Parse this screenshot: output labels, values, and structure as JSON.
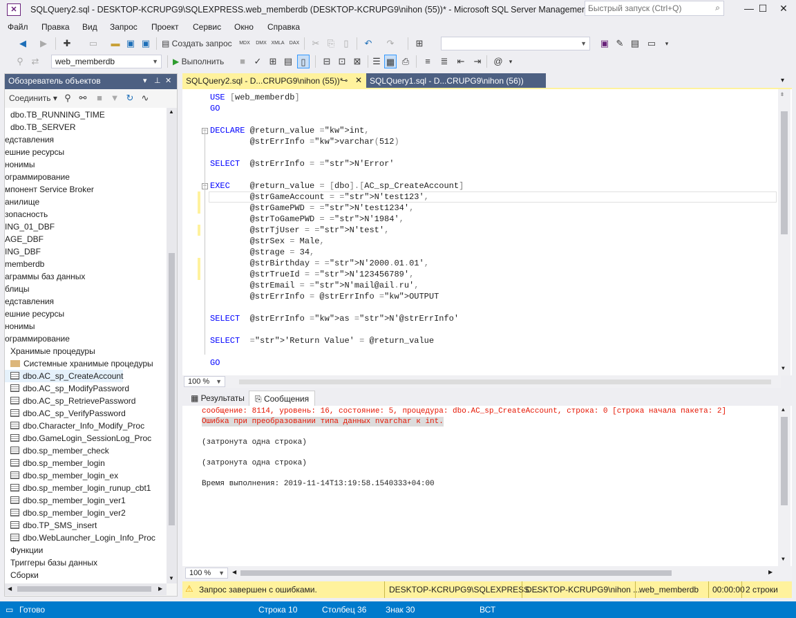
{
  "window": {
    "title": "SQLQuery2.sql - DESKTOP-KCRUPG9\\SQLEXPRESS.web_memberdb (DESKTOP-KCRUPG9\\nihon (55))* - Microsoft SQL Server Management Studio",
    "quick_launch_placeholder": "Быстрый запуск (Ctrl+Q)"
  },
  "menu": [
    "Файл",
    "Правка",
    "Вид",
    "Запрос",
    "Проект",
    "Сервис",
    "Окно",
    "Справка"
  ],
  "toolbar": {
    "new_query": "Создать запрос",
    "mdx": "MDX",
    "dmx": "DMX",
    "xmla": "XMLA",
    "dax": "DAX",
    "database": "web_memberdb",
    "execute": "Выполнить"
  },
  "object_explorer": {
    "title": "Обозреватель объектов",
    "connect": "Соединить",
    "items": [
      "dbo.TB_RUNNING_TIME",
      "dbo.TB_SERVER",
      "едставления",
      "ешние ресурсы",
      "нонимы",
      "ограммирование",
      "мпонент Service Broker",
      "анилище",
      "зопасность",
      "ING_01_DBF",
      "AGE_DBF",
      "ING_DBF",
      "memberdb",
      "аграммы баз данных",
      "блицы",
      "едставления",
      "ешние ресурсы",
      "нонимы",
      "ограммирование",
      "Хранимые процедуры",
      "Системные хранимые процедуры",
      "dbo.AC_sp_CreateAccount",
      "dbo.AC_sp_ModifyPassword",
      "dbo.AC_sp_RetrievePassword",
      "dbo.AC_sp_VerifyPassword",
      "dbo.Character_Info_Modify_Proc",
      "dbo.GameLogin_SessionLog_Proc",
      "dbo.sp_member_check",
      "dbo.sp_member_login",
      "dbo.sp_member_login_ex",
      "dbo.sp_member_login_runup_cbt1",
      "dbo.sp_member_login_ver1",
      "dbo.sp_member_login_ver2",
      "dbo.TP_SMS_insert",
      "dbo.WebLauncher_Login_Info_Proc",
      "Функции",
      "Триггеры базы данных",
      "Сборки"
    ]
  },
  "tabs": {
    "active": "SQLQuery2.sql - D...CRUPG9\\nihon (55))*",
    "inactive": "SQLQuery1.sql - D...CRUPG9\\nihon (56))"
  },
  "editor": {
    "zoom": "100 %",
    "code": [
      {
        "t": "USE",
        "r": " [web_memberdb]"
      },
      {
        "t": "GO",
        "r": ""
      },
      {
        "t": "DECLARE",
        "r": " @return_value int,"
      },
      {
        "t": "",
        "r": "        @strErrInfo varchar(512)"
      },
      {
        "t": "SELECT",
        "r": "  @strErrInfo = N'Error'"
      },
      {
        "t": "EXEC",
        "r": "    @return_value = [dbo].[AC_sp_CreateAccount]"
      },
      {
        "t": "",
        "r": "        @strGameAccount = N'test123',"
      },
      {
        "t": "",
        "r": "        @strGamePWD = N'test1234',"
      },
      {
        "t": "",
        "r": "        @strToGamePWD = N'1984',"
      },
      {
        "t": "",
        "r": "        @strTjUser = N'test',"
      },
      {
        "t": "",
        "r": "        @strSex = Male,"
      },
      {
        "t": "",
        "r": "        @strage = 34,"
      },
      {
        "t": "",
        "r": "        @strBirthday = N'2000.01.01',"
      },
      {
        "t": "",
        "r": "        @strTrueId = N'123456789',"
      },
      {
        "t": "",
        "r": "        @strEmail = N'mail@ail.ru',"
      },
      {
        "t": "",
        "r": "        @strErrInfo = @strErrInfo OUTPUT"
      },
      {
        "t": "SELECT",
        "r": "  @strErrInfo as N'@strErrInfo'"
      },
      {
        "t": "SELECT",
        "r": "  'Return Value' = @return_value"
      },
      {
        "t": "GO",
        "r": ""
      }
    ]
  },
  "results": {
    "tab_results": "Результаты",
    "tab_messages": "Сообщения",
    "error_line1": "сообщение: 8114, уровень: 16, состояние: 5, процедура: dbo.AC_sp_CreateAccount, строка: 0 [строка начала пакета: 2]",
    "error_line2": "Ошибка при преобразовании типа данных nvarchar к int.",
    "line3": "(затронута одна строка)",
    "line4": "(затронута одна строка)",
    "line5": "Время выполнения: 2019-11-14T13:19:58.1540333+04:00",
    "zoom": "100 %"
  },
  "query_status": {
    "message": "Запрос завершен с ошибками.",
    "server": "DESKTOP-KCRUPG9\\SQLEXPRESS ...",
    "user": "DESKTOP-KCRUPG9\\nihon ...",
    "db": "web_memberdb",
    "time": "00:00:00",
    "rows": "2 строки"
  },
  "statusbar": {
    "ready": "Готово",
    "line": "Строка 10",
    "col": "Столбец 36",
    "ch": "Знак 30",
    "mode": "ВСТ"
  },
  "colors": {
    "accent": "#007acc",
    "panel_title": "#4d6082",
    "yellow": "#fff29d",
    "error": "#e51400"
  }
}
